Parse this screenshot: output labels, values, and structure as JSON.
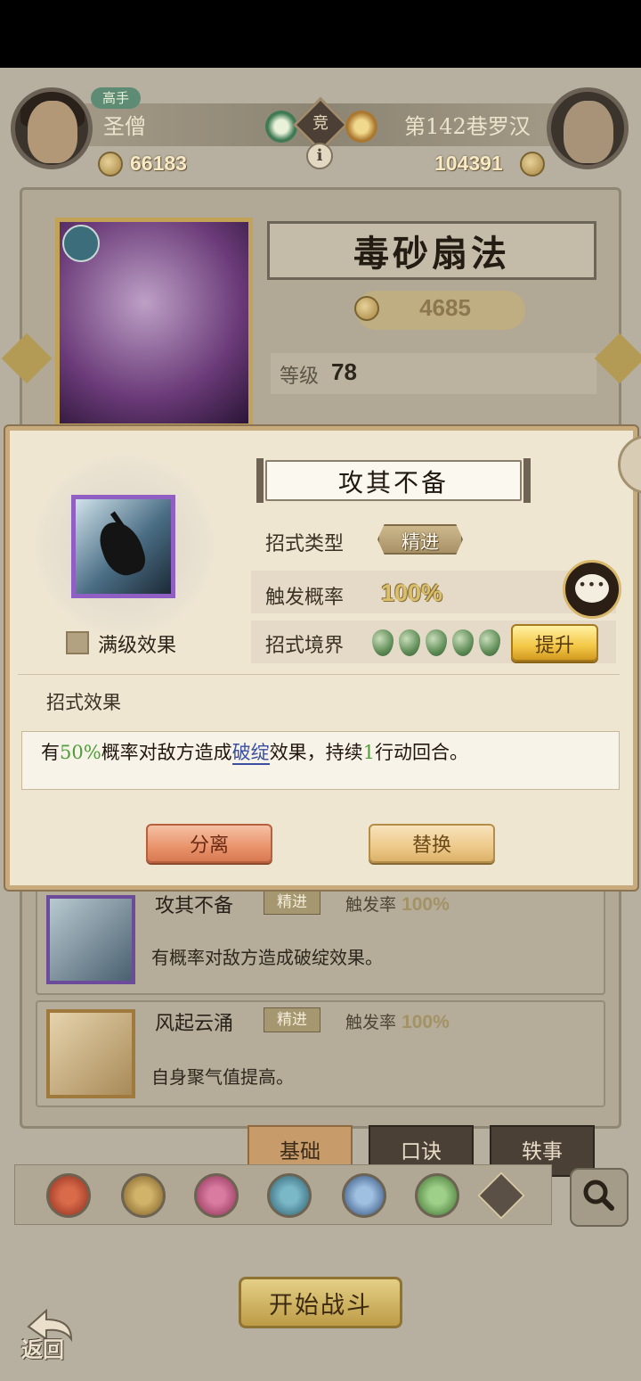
{
  "header": {
    "left_player": {
      "rank": "高手",
      "name": "圣僧",
      "power": "66183"
    },
    "right_player": {
      "name": "第142巷罗汉",
      "power": "104391"
    },
    "vs_label": "竞",
    "info_label": "i"
  },
  "skill_panel": {
    "title": "毒砂扇法",
    "power": "4685",
    "level_label": "等级",
    "level_value": "78"
  },
  "dialog": {
    "skill_name": "攻其不备",
    "max_effect_label": "满级效果",
    "rows": [
      {
        "label": "招式类型",
        "value": "精进"
      },
      {
        "label": "触发概率",
        "value": "100%"
      },
      {
        "label": "招式境界",
        "drops": 5
      }
    ],
    "upgrade_label": "提升",
    "effect_heading": "招式效果",
    "effect_parts": {
      "p1": "有",
      "chance": "50%",
      "p2": "概率对敌方造成",
      "status": "破绽",
      "p3": "效果，持续",
      "turns": "1",
      "p4": "行动回合。"
    },
    "separate_label": "分离",
    "replace_label": "替换",
    "chat_icon": "chat-bubble-icon"
  },
  "skill_list": [
    {
      "name": "攻其不备",
      "type": "精进",
      "rate_label": "触发率",
      "rate": "100%",
      "desc": "有概率对敌方造成破绽效果。"
    },
    {
      "name": "风起云涌",
      "type": "精进",
      "rate_label": "触发率",
      "rate": "100%",
      "desc": "自身聚气值提高。"
    }
  ],
  "tabs": [
    "基础",
    "口诀",
    "轶事"
  ],
  "active_tab": "基础",
  "filter_icons": [
    "blade-icon",
    "sword-icon",
    "palm-icon",
    "fan-icon",
    "taiji-icon",
    "hand-icon",
    "arrow-up-icon"
  ],
  "start_label": "开始战斗",
  "back_label": "返回",
  "colors": {
    "accent_gold": "#f3c746",
    "dialog_bg": "#efe6d2",
    "effect_green": "#4f9e3a",
    "link_blue": "#3a4fa0"
  }
}
